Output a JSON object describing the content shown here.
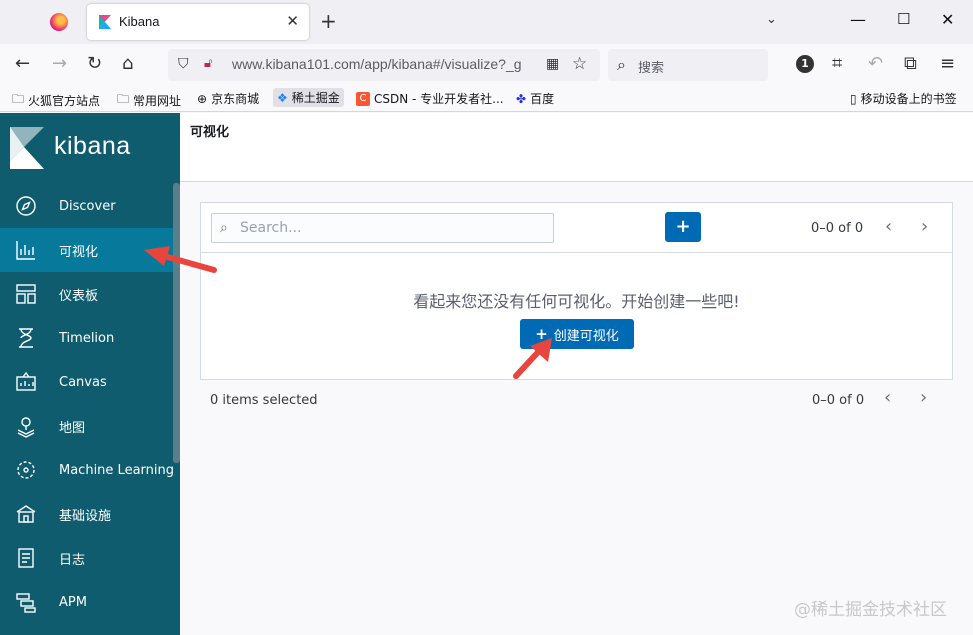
{
  "browser": {
    "tab_title": "Kibana",
    "url": "www.kibana101.com/app/kibana#/visualize?_g",
    "search_placeholder": "搜索",
    "bookmarks": [
      {
        "label": "火狐官方站点"
      },
      {
        "label": "常用网址"
      },
      {
        "label": "京东商城"
      },
      {
        "label": "稀土掘金"
      },
      {
        "label": "CSDN - 专业开发者社..."
      },
      {
        "label": "百度"
      },
      {
        "label": "移动设备上的书签"
      }
    ]
  },
  "sidebar": {
    "brand": "kibana",
    "items": [
      {
        "label": "Discover",
        "icon": "compass-icon"
      },
      {
        "label": "可视化",
        "icon": "visualize-icon"
      },
      {
        "label": "仪表板",
        "icon": "dashboard-icon"
      },
      {
        "label": "Timelion",
        "icon": "timelion-icon"
      },
      {
        "label": "Canvas",
        "icon": "canvas-icon"
      },
      {
        "label": "地图",
        "icon": "map-icon"
      },
      {
        "label": "Machine Learning",
        "icon": "ml-icon"
      },
      {
        "label": "基础设施",
        "icon": "infrastructure-icon"
      },
      {
        "label": "日志",
        "icon": "logs-icon"
      },
      {
        "label": "APM",
        "icon": "apm-icon"
      }
    ]
  },
  "main": {
    "title": "可视化",
    "search_placeholder": "Search...",
    "pager_top": "0–0 of 0",
    "empty_message": "看起来您还没有任何可视化。开始创建一些吧!",
    "create_label": "创建可视化",
    "selected_text": "0 items selected",
    "pager_bottom": "0–0 of 0"
  },
  "watermark": "@稀土掘金技术社区",
  "colors": {
    "sidebar_bg": "#0f5c6e",
    "sidebar_active": "#07799a",
    "primary": "#006bb4",
    "annotation_arrow": "#e8453c"
  }
}
